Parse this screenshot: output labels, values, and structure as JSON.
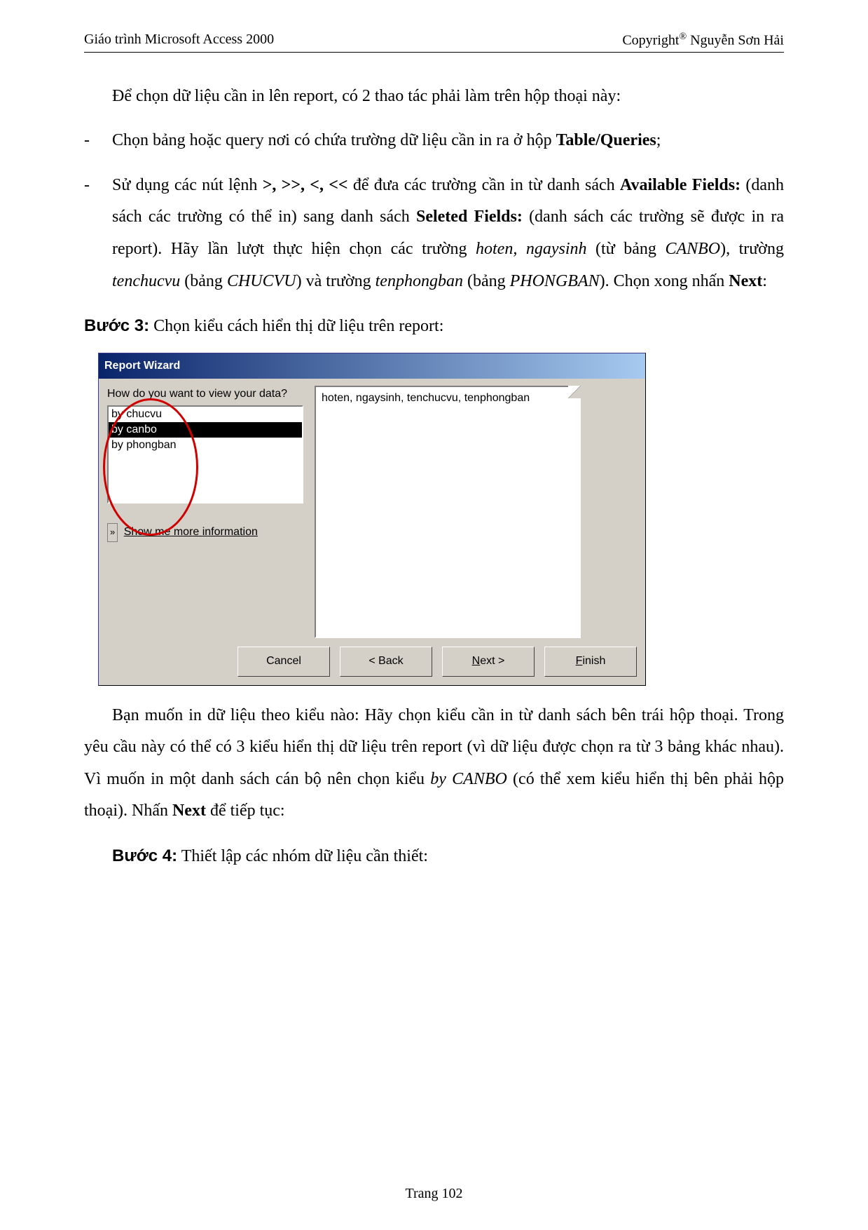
{
  "header": {
    "left": "Giáo trình Microsoft Access 2000",
    "right_prefix": "Copyright",
    "right_sup": "®",
    "right_name": " Nguyễn Sơn Hải"
  },
  "text": {
    "intro": "Để chọn dữ liệu cần in lên report, có 2 thao tác phải làm trên hộp thoại này:",
    "li1_a": "Chọn bảng hoặc query nơi có chứa trường dữ liệu cần in ra ở hộp ",
    "li1_b": "Table/Queries",
    "li1_c": ";",
    "li2_a": "Sử dụng các nút lệnh ",
    "li2_ops": ">, >>, <, <<",
    "li2_b": " để đưa các trường cần in từ danh sách ",
    "li2_c": "Available Fields:",
    "li2_d": " (danh sách các trường có thể in) sang danh sách ",
    "li2_e": "Seleted Fields:",
    "li2_f": " (danh sách các trường sẽ được in ra report). Hãy lần lượt thực hiện chọn các trường ",
    "li2_g": "hoten, ngaysinh",
    "li2_h": " (từ bảng ",
    "li2_i": "CANBO",
    "li2_j": "), trường ",
    "li2_k": "tenchucvu",
    "li2_l": " (bảng ",
    "li2_m": "CHUCVU",
    "li2_n": ") và trường ",
    "li2_o": "tenphongban",
    "li2_p": " (bảng ",
    "li2_q": "PHONGBAN",
    "li2_r": "). Chọn xong nhấn ",
    "li2_s": "Next",
    "li2_t": ":",
    "step3_lbl": "Bước 3:",
    "step3_txt": " Chọn kiểu cách hiển thị dữ liệu trên report:",
    "after_a": "Bạn muốn in dữ liệu theo kiểu nào: Hãy chọn kiểu cần in từ danh sách bên trái hộp thoại. Trong yêu cầu này có thể có 3 kiểu hiển thị dữ liệu trên report (vì dữ liệu được chọn ra từ 3 bảng khác nhau). Vì muốn in một danh sách cán bộ nên chọn kiểu ",
    "after_b": "by CANBO",
    "after_c": " (có thể xem kiểu hiển thị bên phải hộp thoại). Nhấn ",
    "after_d": "Next",
    "after_e": " để tiếp tục:",
    "step4_lbl": "Bước 4:",
    "step4_txt": " Thiết lập các nhóm dữ liệu cần thiết:"
  },
  "dialog": {
    "title": "Report Wizard",
    "question": "How do you want to view your data?",
    "options": [
      "by chucvu",
      "by canbo",
      "by phongban"
    ],
    "selected_index": 1,
    "more_arrow": "»",
    "more_info": "Show me more information",
    "preview": "hoten, ngaysinh, tenchucvu, tenphongban",
    "btn_cancel": "Cancel",
    "btn_back": "< Back",
    "btn_next_pre": "N",
    "btn_next_post": "ext >",
    "btn_finish_pre": "F",
    "btn_finish_post": "inish"
  },
  "footer": "Trang 102"
}
